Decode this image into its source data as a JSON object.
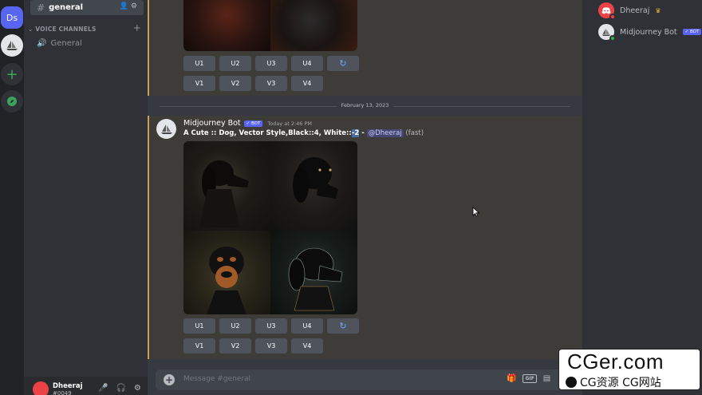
{
  "servers": [
    {
      "label": "Ds"
    }
  ],
  "channels": {
    "active": "general",
    "voice_category": "VOICE CHANNELS",
    "voice_channel": "General"
  },
  "user": {
    "name": "Dheeraj",
    "tag": "#0049"
  },
  "chat": {
    "top_buttons": {
      "u": [
        "U1",
        "U2",
        "U3",
        "U4"
      ],
      "v": [
        "V1",
        "V2",
        "V3",
        "V4"
      ]
    },
    "date_divider": "February 13, 2023",
    "message": {
      "author": "Midjourney Bot",
      "bot_tag": "✓ BOT",
      "time": "Today at 2:46 PM",
      "prompt_main": "A Cute :: Dog, Vector Style,Black::4, White::",
      "prompt_selected": "-2",
      "prompt_sep": " - ",
      "mention": "@Dheeraj",
      "speed": "(fast)"
    },
    "bottom_buttons": {
      "u": [
        "U1",
        "U2",
        "U3",
        "U4"
      ],
      "v": [
        "V1",
        "V2",
        "V3",
        "V4"
      ]
    },
    "composer_placeholder": "Message #general"
  },
  "members": [
    {
      "name": "Dheeraj",
      "status": "dnd"
    },
    {
      "name": "Midjourney Bot",
      "bot_tag": "✓ BOT",
      "status": "online"
    }
  ],
  "watermark": {
    "title": "CGer.com",
    "subtitle": "CG资源 CG网站"
  },
  "colors": {
    "accent": "#5865f2",
    "highlight_border": "#c8a25a",
    "reroll": "#6fa8ff",
    "online": "#3ba55d",
    "dnd": "#ed4245"
  }
}
